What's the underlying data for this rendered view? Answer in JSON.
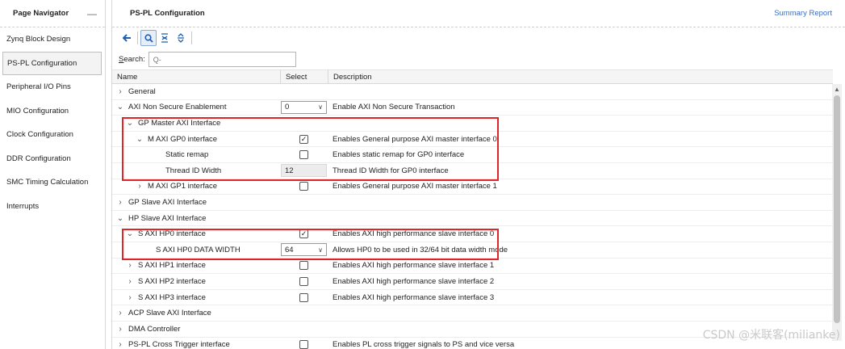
{
  "sidebar": {
    "title": "Page Navigator",
    "minimize_glyph": "—",
    "items": [
      {
        "label": "Zynq Block Design"
      },
      {
        "label": "PS-PL Configuration"
      },
      {
        "label": "Peripheral I/O Pins"
      },
      {
        "label": "MIO Configuration"
      },
      {
        "label": "Clock Configuration"
      },
      {
        "label": "DDR Configuration"
      },
      {
        "label": "SMC Timing Calculation"
      },
      {
        "label": "Interrupts"
      }
    ],
    "active_index": 1
  },
  "main": {
    "title": "PS-PL Configuration",
    "summary_link": "Summary Report",
    "toolbar_icons": [
      "back-arrow-icon",
      "search-icon",
      "collapse-all-icon",
      "expand-all-icon"
    ],
    "search": {
      "label_prefix": "S",
      "label_rest": "earch:",
      "placeholder": "Q-"
    },
    "columns": {
      "name": "Name",
      "select": "Select",
      "description": "Description"
    },
    "rows": [
      {
        "indent": 0,
        "chevron": "›",
        "name": "General",
        "select_type": "none",
        "select_value": "",
        "description": ""
      },
      {
        "indent": 0,
        "chevron": "⌄",
        "name": "AXI Non Secure Enablement",
        "select_type": "dropdown",
        "select_value": "0",
        "description": "Enable AXI Non Secure Transaction"
      },
      {
        "indent": 1,
        "chevron": "⌄",
        "name": "GP Master AXI Interface",
        "select_type": "none",
        "select_value": "",
        "description": ""
      },
      {
        "indent": 2,
        "chevron": "⌄",
        "name": "M AXI GP0 interface",
        "select_type": "checkbox",
        "select_value": "✓",
        "description": "Enables General purpose AXI master interface 0"
      },
      {
        "indent": 3,
        "chevron": "",
        "name": "Static remap",
        "select_type": "checkbox",
        "select_value": "",
        "description": "Enables static remap for GP0 interface"
      },
      {
        "indent": 3,
        "chevron": "",
        "name": "Thread ID Width",
        "select_type": "readonly",
        "select_value": "12",
        "description": "Thread ID Width for GP0 interface"
      },
      {
        "indent": 2,
        "chevron": "›",
        "name": "M AXI GP1 interface",
        "select_type": "checkbox",
        "select_value": "",
        "description": "Enables General purpose AXI master interface 1"
      },
      {
        "indent": 0,
        "chevron": "›",
        "name": "GP Slave AXI Interface",
        "select_type": "none",
        "select_value": "",
        "description": ""
      },
      {
        "indent": 0,
        "chevron": "⌄",
        "name": "HP Slave AXI Interface",
        "select_type": "none",
        "select_value": "",
        "description": ""
      },
      {
        "indent": 1,
        "chevron": "⌄",
        "name": "S AXI HP0 interface",
        "select_type": "checkbox",
        "select_value": "✓",
        "description": "Enables AXI high performance slave interface 0"
      },
      {
        "indent": 2,
        "chevron": "",
        "name": "S AXI HP0 DATA WIDTH",
        "select_type": "dropdown",
        "select_value": "64",
        "description": "Allows HP0 to be used in 32/64 bit data width mode"
      },
      {
        "indent": 1,
        "chevron": "›",
        "name": "S AXI HP1 interface",
        "select_type": "checkbox",
        "select_value": "",
        "description": "Enables AXI high performance slave interface 1"
      },
      {
        "indent": 1,
        "chevron": "›",
        "name": "S AXI HP2 interface",
        "select_type": "checkbox",
        "select_value": "",
        "description": "Enables AXI high performance slave interface 2"
      },
      {
        "indent": 1,
        "chevron": "›",
        "name": "S AXI HP3 interface",
        "select_type": "checkbox",
        "select_value": "",
        "description": "Enables AXI high performance slave interface 3"
      },
      {
        "indent": 0,
        "chevron": "›",
        "name": "ACP Slave AXI Interface",
        "select_type": "none",
        "select_value": "",
        "description": ""
      },
      {
        "indent": 0,
        "chevron": "›",
        "name": "DMA Controller",
        "select_type": "none",
        "select_value": "",
        "description": ""
      },
      {
        "indent": 0,
        "chevron": "›",
        "name": "PS-PL Cross Trigger interface",
        "select_type": "checkbox",
        "select_value": "",
        "description": "Enables PL cross trigger signals to PS and vice versa"
      }
    ]
  },
  "watermark": "CSDN @米联客(milianke)",
  "colors": {
    "highlight": "#e0242a",
    "link": "#3a6fc4",
    "toolbar_icon": "#1d5fb3"
  }
}
